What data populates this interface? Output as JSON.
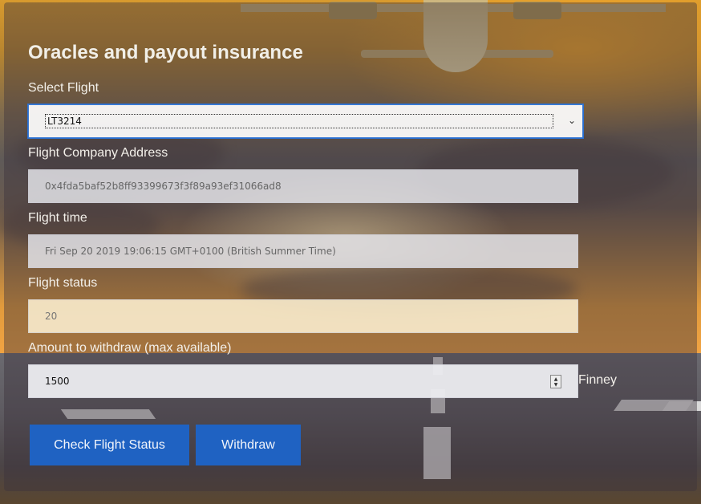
{
  "form": {
    "title": "Oracles and payout insurance",
    "select_flight": {
      "label": "Select Flight",
      "value": "LT3214"
    },
    "company_address": {
      "label": "Flight Company Address",
      "value": "0x4fda5baf52b8ff93399673f3f89a93ef31066ad8"
    },
    "flight_time": {
      "label": "Flight time",
      "value": "Fri Sep 20 2019 19:06:15 GMT+0100 (British Summer Time)"
    },
    "flight_status": {
      "label": "Flight status",
      "value": "20"
    },
    "withdraw_amount": {
      "label": "Amount to withdraw (max available)",
      "value": "1500",
      "unit": "Finney"
    }
  },
  "buttons": {
    "check_status": "Check Flight Status",
    "withdraw": "Withdraw"
  },
  "icons": {
    "select_chevron": "chevron-down-icon",
    "number_spinner": "spinner-icon"
  },
  "colors": {
    "accent": "#1f62c2",
    "focus_border": "#3a7bd5"
  }
}
